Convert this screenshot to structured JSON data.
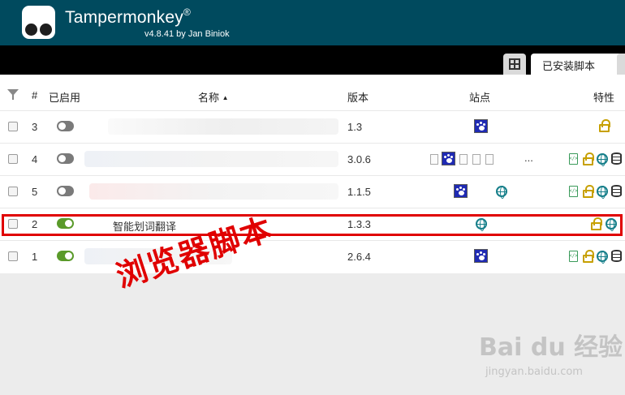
{
  "app": {
    "title": "Tampermonkey",
    "reg": "®",
    "version": "v4.8.41 by Jan Biniok"
  },
  "tabs": {
    "installed": "已安装脚本"
  },
  "columns": {
    "index": "#",
    "enabled": "已启用",
    "name": "名称",
    "sort_indicator": "▲",
    "version": "版本",
    "sites": "站点",
    "features": "特性"
  },
  "rows": [
    {
      "index": "3",
      "enabled": false,
      "name": "",
      "version": "1.3"
    },
    {
      "index": "4",
      "enabled": false,
      "name": "",
      "version": "3.0.6",
      "sites_more": "..."
    },
    {
      "index": "5",
      "enabled": false,
      "name": "",
      "version": "1.1.5"
    },
    {
      "index": "2",
      "enabled": true,
      "name": "智能划词翻译",
      "version": "1.3.3"
    },
    {
      "index": "1",
      "enabled": true,
      "name": "",
      "version": "2.6.4"
    }
  ],
  "annotation": "浏览器脚本",
  "watermark": {
    "brand": "Bai du 经验",
    "url": "jingyan.baidu.com"
  },
  "colors": {
    "header_bg": "#004a5e",
    "toggle_on": "#5a9a2a",
    "highlight": "#e00000"
  }
}
